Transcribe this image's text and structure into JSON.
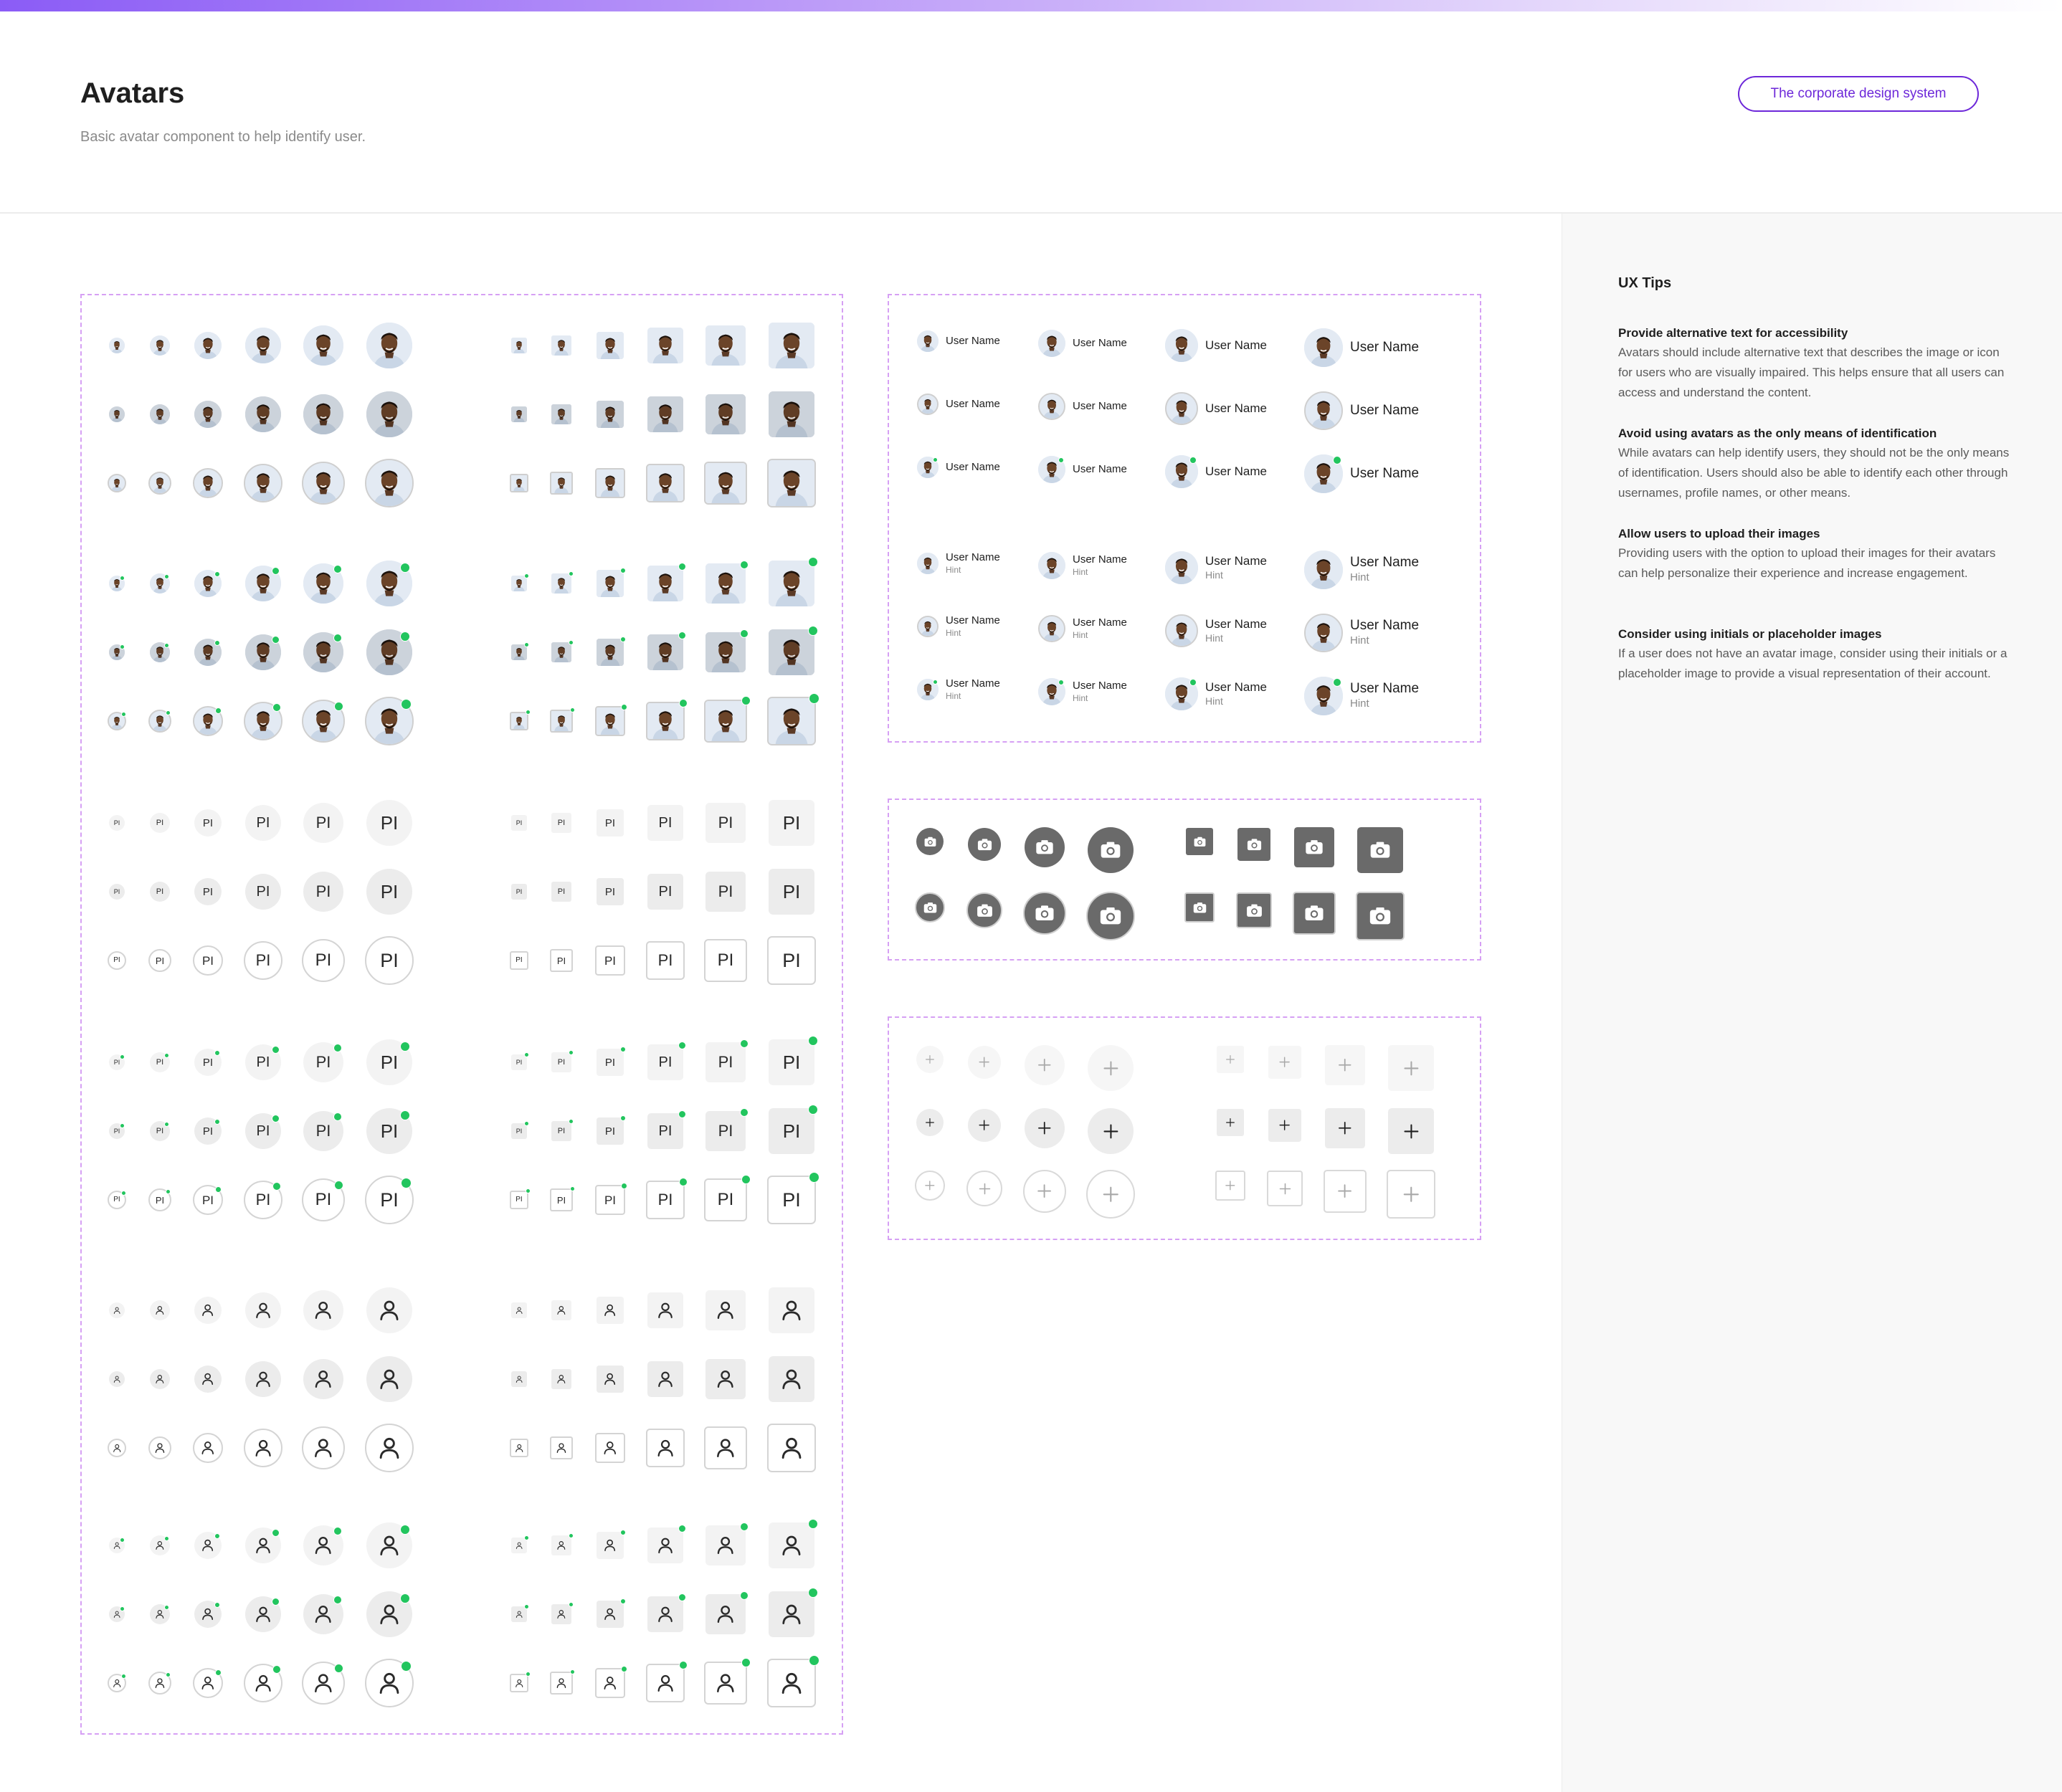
{
  "header": {
    "title": "Avatars",
    "subtitle": "Basic avatar component to help identify user.",
    "design_system_link": "The corporate design system"
  },
  "avatar_grid": {
    "initials": "PI",
    "status_color": "#22c55e",
    "accent_color": "#6d28d9",
    "icons": [
      "person-icon",
      "camera-icon",
      "plus-icon"
    ]
  },
  "user_list": {
    "name": "User Name",
    "hint": "Hint"
  },
  "ux_tips": {
    "heading": "UX Tips",
    "items": [
      {
        "title": "Provide alternative text for accessibility",
        "body": "Avatars should include alternative text that describes the image or icon for users who are visually impaired. This helps ensure that all users can access and understand the content."
      },
      {
        "title": "Avoid using avatars as the only means of identification",
        "body": "While avatars can help identify users, they should not be the only means of identification. Users should also be able to identify each other through usernames, profile names, or other means."
      },
      {
        "title": "Allow users to upload their images",
        "body": "Providing users with the option to upload their images for their avatars can help personalize their experience and increase engagement."
      },
      {
        "title": "Consider using initials or placeholder images",
        "body": "If a user does not have an avatar image, consider using their initials or a placeholder image to provide a visual representation of their account."
      }
    ]
  }
}
